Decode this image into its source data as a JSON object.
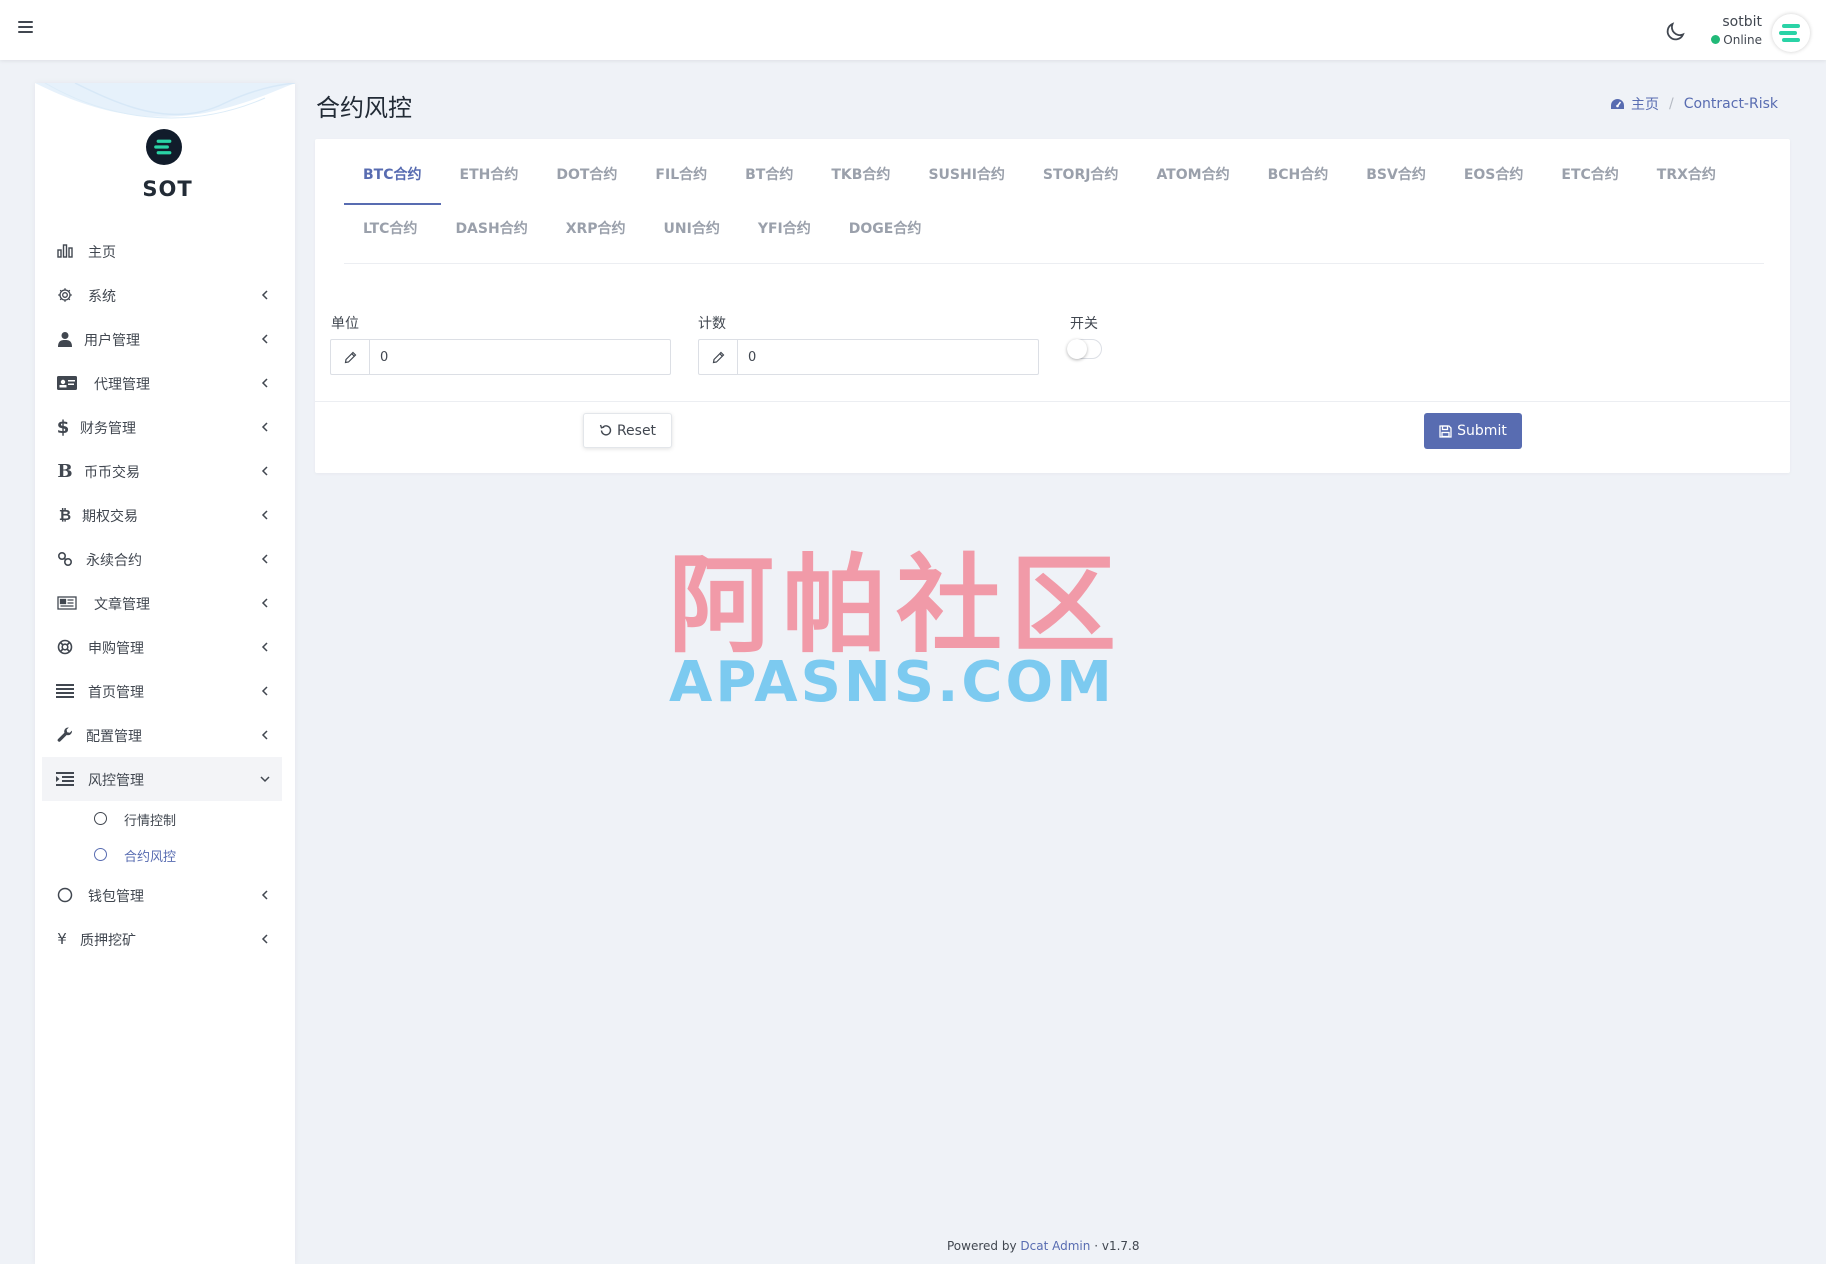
{
  "header": {
    "user_name": "sotbit",
    "user_status": "Online"
  },
  "sidebar": {
    "brand": "SOT",
    "items": [
      {
        "label": "主页",
        "icon": "bar-chart-icon"
      },
      {
        "label": "系统",
        "icon": "gear-icon"
      },
      {
        "label": "用户管理",
        "icon": "user-tie-icon"
      },
      {
        "label": "代理管理",
        "icon": "id-card-icon"
      },
      {
        "label": "财务管理",
        "icon": "dollar-icon"
      },
      {
        "label": "币币交易",
        "icon": "bold-b-icon"
      },
      {
        "label": "期权交易",
        "icon": "bitcoin-icon"
      },
      {
        "label": "永续合约",
        "icon": "link-icon"
      },
      {
        "label": "文章管理",
        "icon": "newspaper-icon"
      },
      {
        "label": "申购管理",
        "icon": "life-ring-icon"
      },
      {
        "label": "首页管理",
        "icon": "list-icon"
      },
      {
        "label": "配置管理",
        "icon": "wrench-icon"
      },
      {
        "label": "风控管理",
        "icon": "indent-icon"
      },
      {
        "label": "钱包管理",
        "icon": "circle-icon"
      },
      {
        "label": "质押挖矿",
        "icon": "yen-icon"
      }
    ],
    "sub_items": [
      {
        "label": "行情控制"
      },
      {
        "label": "合约风控"
      }
    ]
  },
  "page": {
    "title": "合约风控",
    "breadcrumb_home": "主页",
    "breadcrumb_current": "Contract-Risk"
  },
  "tabs": [
    "BTC合约",
    "ETH合约",
    "DOT合约",
    "FIL合约",
    "BT合约",
    "TKB合约",
    "SUSHI合约",
    "STORJ合约",
    "ATOM合约",
    "BCH合约",
    "BSV合约",
    "EOS合约",
    "ETC合约",
    "TRX合约",
    "LTC合约",
    "DASH合约",
    "XRP合约",
    "UNI合约",
    "YFI合约",
    "DOGE合约"
  ],
  "form": {
    "unit_label": "单位",
    "unit_value": "0",
    "count_label": "计数",
    "count_value": "0",
    "switch_label": "开关",
    "switch_on": false,
    "reset_label": "Reset",
    "submit_label": "Submit"
  },
  "watermark": {
    "cn": "阿帕社区",
    "en": "APASNS.COM"
  },
  "footer": {
    "powered_prefix": "Powered by",
    "powered_link": "Dcat Admin",
    "separator": "·",
    "version": "v1.7.8"
  },
  "colors": {
    "accent": "#586cb1",
    "online": "#21b978",
    "brand_teal": "#2ad3a6"
  }
}
